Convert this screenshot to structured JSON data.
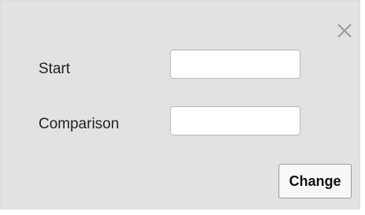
{
  "dialog": {
    "close_icon": "close-icon",
    "background_color": "#e2e2e2",
    "fields": {
      "start": {
        "label": "Start",
        "value": "",
        "placeholder": ""
      },
      "comparison": {
        "label": "Comparison",
        "value": "",
        "placeholder": ""
      }
    },
    "change_button_label": "Change"
  }
}
